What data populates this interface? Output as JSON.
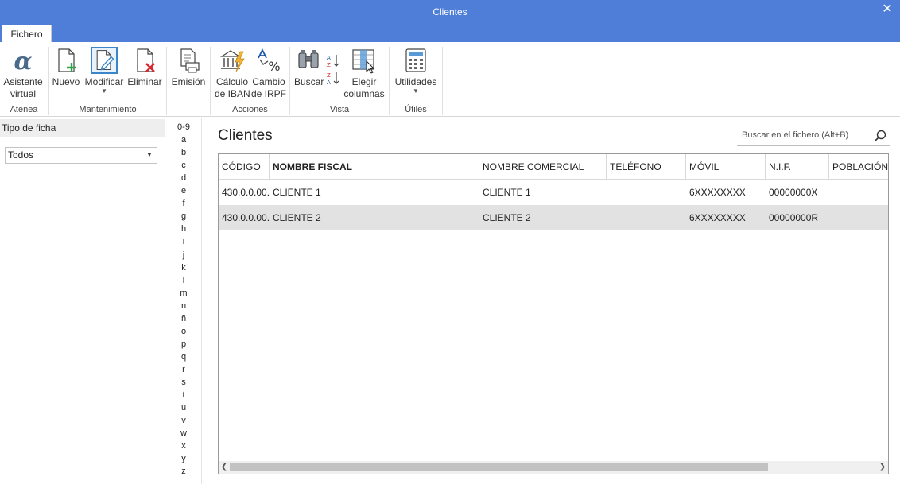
{
  "window": {
    "title": "Clientes",
    "close_glyph": "✕"
  },
  "ribbon": {
    "tab_label": "Fichero",
    "buttons": {
      "asistente": {
        "line1": "Asistente",
        "line2": "virtual",
        "icon": "alpha-icon"
      },
      "nuevo": {
        "label": "Nuevo",
        "icon": "new-document-icon"
      },
      "modificar": {
        "label": "Modificar",
        "icon": "edit-document-icon"
      },
      "eliminar": {
        "label": "Eliminar",
        "icon": "delete-document-icon"
      },
      "emision": {
        "label": "Emisión",
        "icon": "print-icon"
      },
      "iban": {
        "line1": "Cálculo",
        "line2": "de IBAN",
        "icon": "bank-icon"
      },
      "irpf": {
        "line1": "Cambio",
        "line2": "de IRPF",
        "icon": "percent-icon"
      },
      "buscar": {
        "label": "Buscar",
        "icon": "binoculars-icon"
      },
      "elegir": {
        "line1": "Elegir",
        "line2": "columnas",
        "icon": "columns-icon"
      },
      "utilidades": {
        "label": "Utilidades",
        "icon": "calculator-icon"
      }
    },
    "groups": {
      "atenea": "Atenea",
      "mantenimiento": "Mantenimiento",
      "acciones": "Acciones",
      "vista": "Vista",
      "utiles": "Útiles"
    }
  },
  "left_panel": {
    "header": "Tipo de ficha",
    "select_value": "Todos"
  },
  "alphabet": [
    "0-9",
    "a",
    "b",
    "c",
    "d",
    "e",
    "f",
    "g",
    "h",
    "i",
    "j",
    "k",
    "l",
    "m",
    "n",
    "ñ",
    "o",
    "p",
    "q",
    "r",
    "s",
    "t",
    "u",
    "v",
    "w",
    "x",
    "y",
    "z"
  ],
  "main": {
    "title": "Clientes",
    "search_placeholder": "Buscar en el fichero (Alt+B)"
  },
  "table": {
    "columns": [
      "CÓDIGO",
      "NOMBRE FISCAL",
      "NOMBRE COMERCIAL",
      "TELÉFONO",
      "MÓVIL",
      "N.I.F.",
      "POBLACIÓN"
    ],
    "rows": [
      [
        "430.0.0.00...",
        "CLIENTE 1",
        "CLIENTE 1",
        "",
        "6XXXXXXXX",
        "00000000X",
        ""
      ],
      [
        "430.0.0.00...",
        "CLIENTE 2",
        "CLIENTE 2",
        "",
        "6XXXXXXXX",
        "00000000R",
        ""
      ]
    ]
  },
  "colors": {
    "titlebar": "#4f7ed8",
    "selected_row": "#e2e2e2",
    "accent": "#3a86c8"
  }
}
